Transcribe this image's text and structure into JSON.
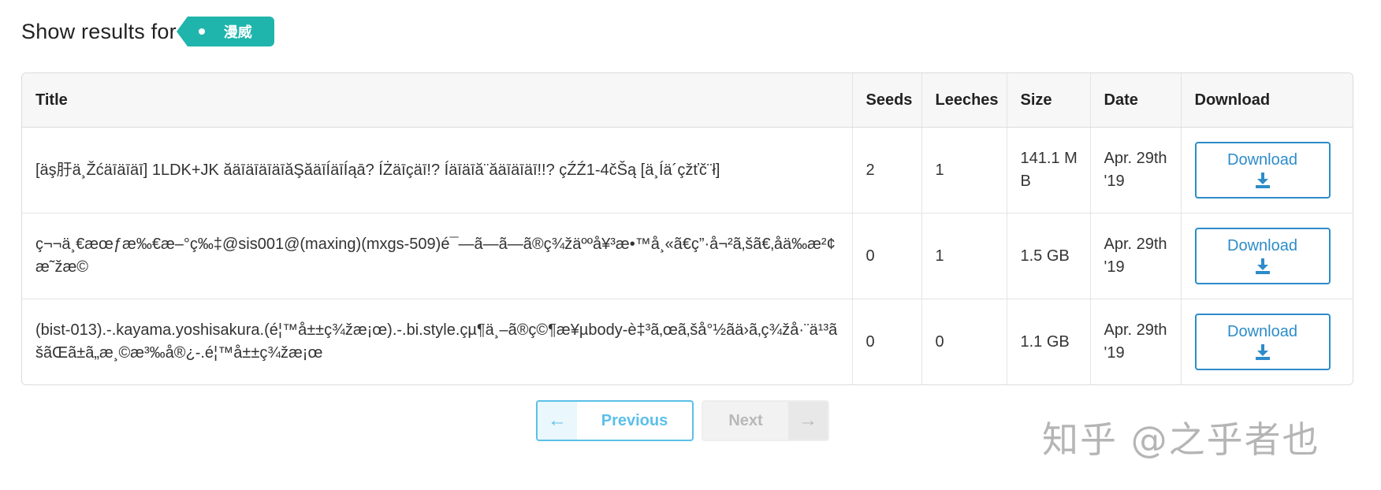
{
  "header": {
    "label": "Show results for",
    "tag": "漫威"
  },
  "table": {
    "columns": [
      "Title",
      "Seeds",
      "Leeches",
      "Size",
      "Date",
      "Download"
    ],
    "rows": [
      {
        "title": "[äş䏏ä¸Žćäīäīäī] 1LDK+JK ăäīäīäīäīăŞăäīÍäīÍąā? ÍŻäīçäī!? Íäīäīă¨ăäīäīäī!!? çŹŹ1-4čŠą [ä¸Íä´çžťč¨ł]",
        "seeds": "2",
        "leeches": "1",
        "size": "141.1 MB",
        "date": "Apr. 29th '19",
        "download": "Download"
      },
      {
        "title": "ç¬¬ä¸€æœƒæ‰€æ–°ç‰‡@sis001@(maxing)(mxgs-509)é¯—ã—ã—ã®ç¾žäººå¥³æ•™å¸«ã€ç”·å¬²ã‚šã€‚åä‰æ²¢æ˜žæ©",
        "seeds": "0",
        "leeches": "1",
        "size": "1.5 GB",
        "date": "Apr. 29th '19",
        "download": "Download"
      },
      {
        "title": "(bist-013).-.kayama.yoshisakura.(é¦™å±±ç¾žæ¡œ).-.bi.style.çµ¶ä¸–ã®ç©¶æ¥µbody-è‡³ã‚œã‚šå°½ãä›ã‚ç¾žå·¨ä¹³ãšãŒã±ã„æ¸©æ³‰å®¿-.é¦™å±±ç¾žæ¡œ",
        "seeds": "0",
        "leeches": "0",
        "size": "1.1 GB",
        "date": "Apr. 29th '19",
        "download": "Download"
      }
    ]
  },
  "pagination": {
    "previous": "Previous",
    "next": "Next",
    "previous_arrow": "←",
    "next_arrow": "→"
  },
  "watermark": "知乎 @之乎者也",
  "colors": {
    "accent": "#2d8cc9",
    "tag": "#1fb5ac",
    "pager_active": "#5bc0e8"
  }
}
